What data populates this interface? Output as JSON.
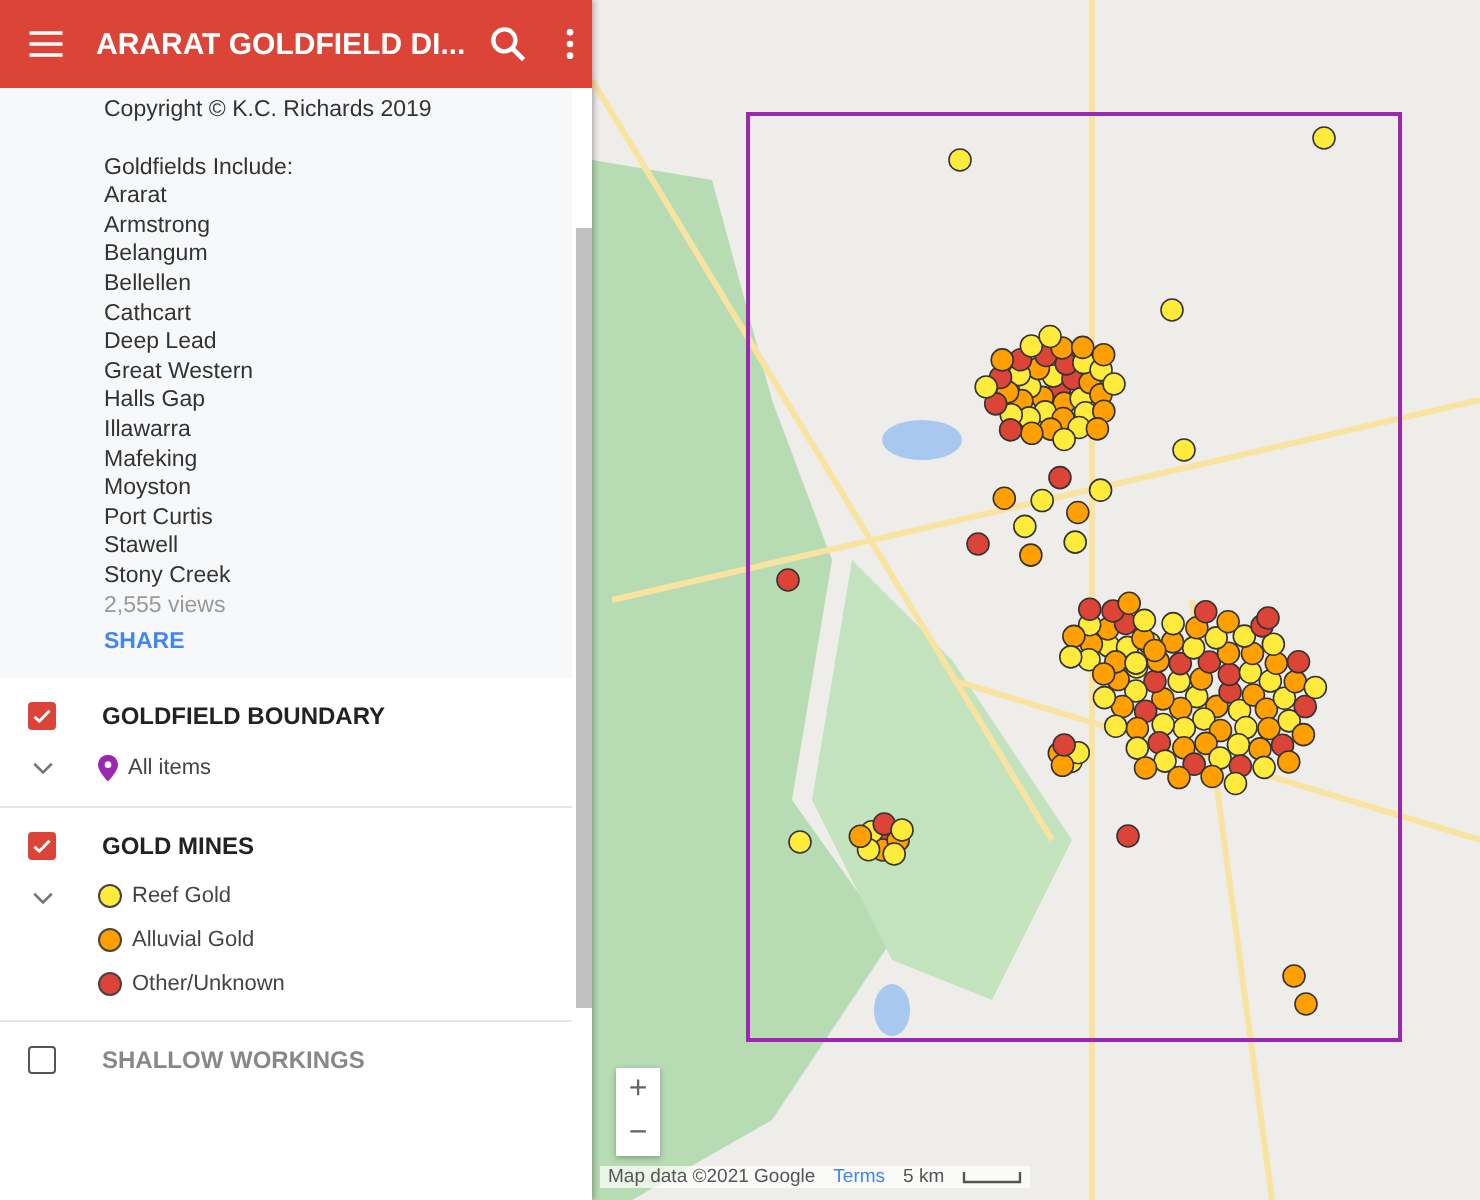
{
  "header": {
    "title": "ARARAT GOLDFIELD DI..."
  },
  "description": {
    "copyright": "Copyright © K.C. Richards 2019",
    "list_heading": "Goldfields Include:",
    "goldfields": [
      "Ararat",
      "Armstrong",
      "Belangum",
      "Bellellen",
      "Cathcart",
      "Deep Lead",
      "Great Western",
      "Halls Gap",
      "Illawarra",
      "Mafeking",
      "Moyston",
      "Port Curtis",
      "Stawell",
      "Stony Creek"
    ],
    "views": "2,555 views",
    "share": "SHARE"
  },
  "layers": [
    {
      "title": "GOLDFIELD BOUNDARY",
      "checked": true,
      "items": [
        {
          "label": "All items",
          "kind": "pin",
          "color": "#9c27b0"
        }
      ]
    },
    {
      "title": "GOLD MINES",
      "checked": true,
      "items": [
        {
          "label": "Reef Gold",
          "kind": "dot",
          "color": "#ffeb3b"
        },
        {
          "label": "Alluvial Gold",
          "kind": "dot",
          "color": "#ffa000"
        },
        {
          "label": "Other/Unknown",
          "kind": "dot",
          "color": "#db4437"
        }
      ]
    },
    {
      "title": "SHALLOW WORKINGS",
      "checked": false
    }
  ],
  "map": {
    "zoom_in": "+",
    "zoom_out": "−",
    "attribution": "Map data ©2021 Google",
    "terms": "Terms",
    "scale": "5 km"
  }
}
